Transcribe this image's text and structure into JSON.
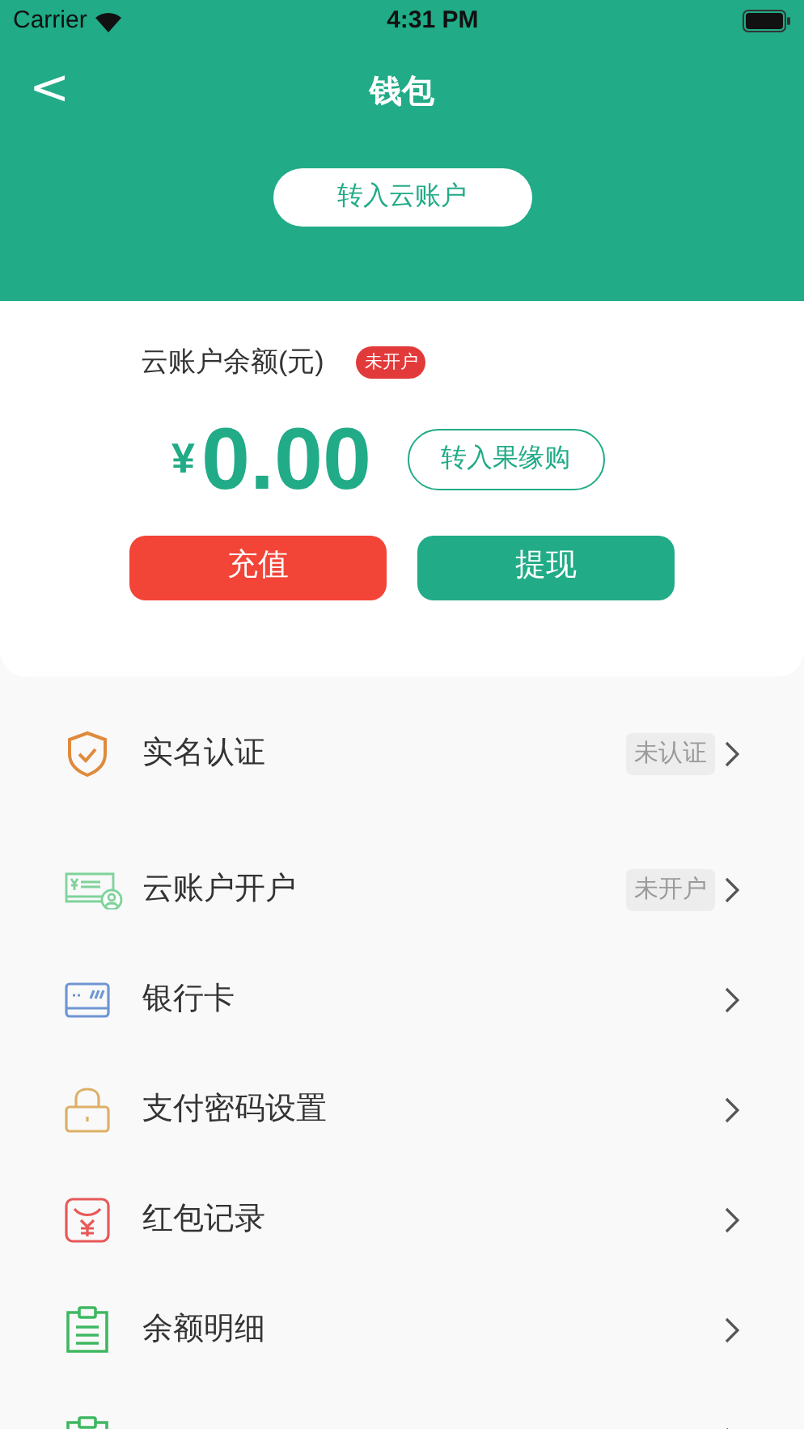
{
  "status_bar": {
    "carrier": "Carrier",
    "time": "4:31 PM"
  },
  "nav": {
    "title": "钱包",
    "back": "<"
  },
  "header_button": "转入云账户",
  "balance": {
    "label": "云账户余额(元)",
    "badge": "未开户",
    "currency": "¥",
    "amount": "0.00",
    "transfer_button": "转入果缘购",
    "recharge_button": "充值",
    "withdraw_button": "提现"
  },
  "menu": [
    {
      "kind": "shield",
      "label": "实名认证",
      "badge": "未认证"
    },
    {
      "kind": "account",
      "label": "云账户开户",
      "badge": "未开户"
    },
    {
      "kind": "card",
      "label": "银行卡"
    },
    {
      "kind": "lock",
      "label": "支付密码设置"
    },
    {
      "kind": "envelope",
      "label": "红包记录"
    },
    {
      "kind": "clipboard",
      "label": "余额明细"
    },
    {
      "kind": "partial"
    }
  ]
}
